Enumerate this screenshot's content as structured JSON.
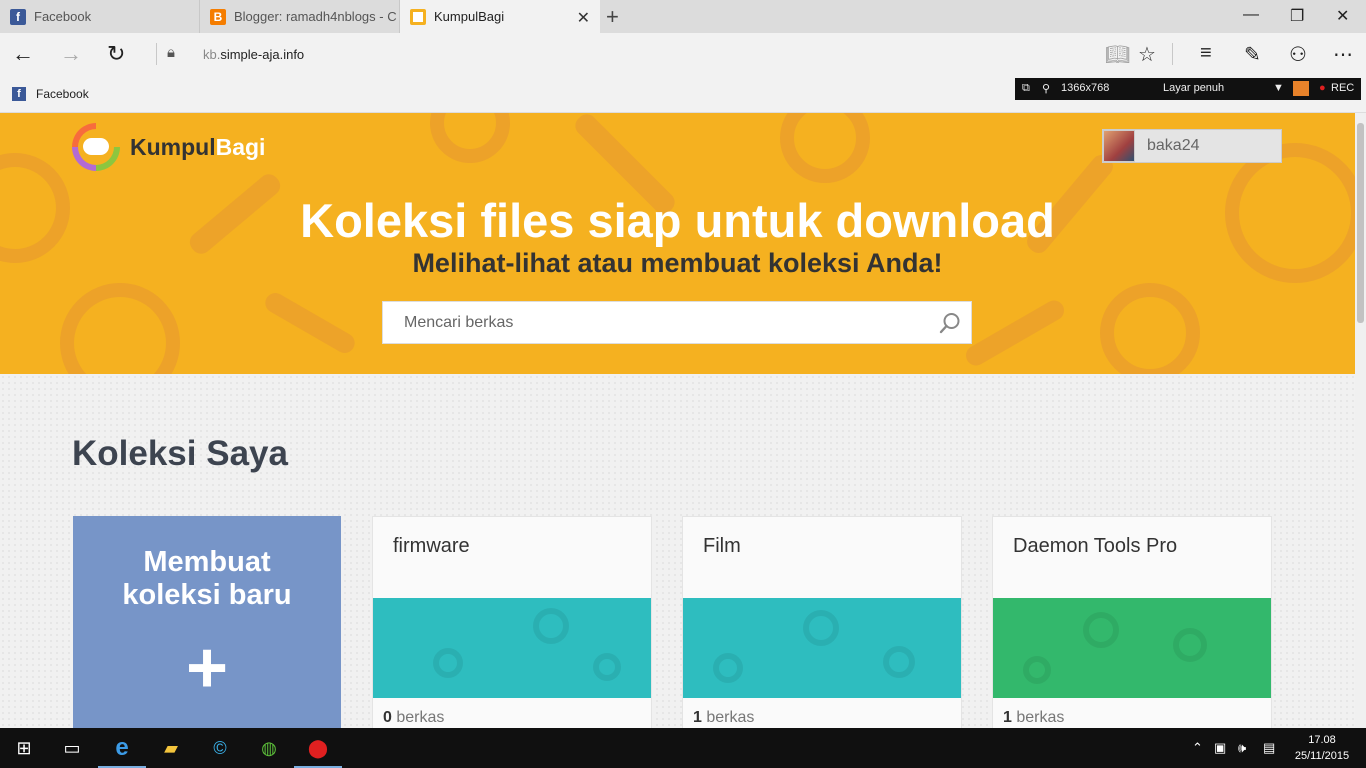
{
  "browser": {
    "tabs": [
      {
        "title": "Facebook",
        "icon": "facebook-icon"
      },
      {
        "title": "Blogger: ramadh4nblogs - C",
        "icon": "blogger-icon"
      },
      {
        "title": "KumpulBagi",
        "icon": "kumpulbagi-icon"
      }
    ],
    "url_domain_prefix": "kb.",
    "url_rest": "simple-aja.info",
    "favorites": [
      {
        "label": "Facebook",
        "icon": "facebook-icon"
      }
    ]
  },
  "recorder": {
    "resolution": "1366x768",
    "mode": "Layar penuh",
    "rec_label": "REC"
  },
  "site": {
    "logo_part1": "Kumpul",
    "logo_part2": "Bagi",
    "username": "baka24",
    "hero_title": "Koleksi files siap untuk download",
    "hero_subtitle": "Melihat-lihat atau membuat koleksi Anda!",
    "search_placeholder": "Mencari berkas",
    "section_title": "Koleksi Saya",
    "new_collection_line1": "Membuat",
    "new_collection_line2": "koleksi baru",
    "new_collection_plus": "+",
    "collections": [
      {
        "name": "firmware",
        "count": "0",
        "unit": "berkas",
        "color": "#2ebdbf"
      },
      {
        "name": "Film",
        "count": "1",
        "unit": "berkas",
        "color": "#2ebdbf"
      },
      {
        "name": "Daemon Tools Pro",
        "count": "1",
        "unit": "berkas",
        "color": "#33b86c"
      }
    ]
  },
  "colors": {
    "hero": "#f5b120",
    "new_card": "#7795c8",
    "teal": "#2ebdbf",
    "green": "#33b86c"
  },
  "taskbar": {
    "time": "17.08",
    "date": "25/11/2015"
  }
}
